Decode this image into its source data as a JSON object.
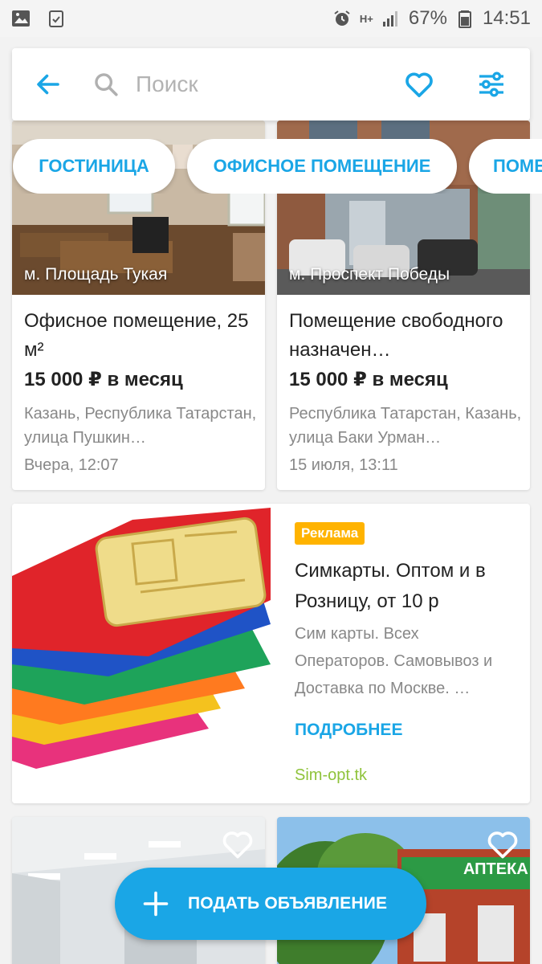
{
  "status_bar": {
    "network": "H+",
    "battery": "67%",
    "time": "14:51"
  },
  "search": {
    "placeholder": "Поиск"
  },
  "chips": [
    "ГОСТИНИЦА",
    "ОФИСНОЕ ПОМЕЩЕНИЕ",
    "ПОМЕЩ"
  ],
  "listings": [
    {
      "metro": "м. Площадь Тукая",
      "title": "Офисное помещение, 25 м²",
      "price": "15 000 ₽ в месяц",
      "address": "Казань, Республика Татарстан, улица Пушкин…",
      "date": "Вчера, 12:07"
    },
    {
      "metro": "м. Проспект Победы",
      "title": "Помещение свободного назначен…",
      "price": "15 000 ₽ в месяц",
      "address": "Республика Татарстан, Казань, улица Баки Урман…",
      "date": "15 июля, 13:11"
    }
  ],
  "ad": {
    "badge": "Реклама",
    "title": "Симкарты. Оптом и в Розницу, от 10 р",
    "description": "Сим карты. Всех Операторов. Самовывоз и Доставка по Москве. …",
    "more": "ПОДРОБНЕЕ",
    "site": "Sim-opt.tk"
  },
  "bottom_listings": [
    {
      "image": "office-interior"
    },
    {
      "image": "pharmacy-building",
      "sign": "АПТЕКА"
    }
  ],
  "fab": {
    "label": "ПОДАТЬ ОБЪЯВЛЕНИЕ"
  },
  "colors": {
    "accent": "#1aa6e6",
    "ad_badge": "#ffb300",
    "ad_site": "#8fc33b"
  }
}
